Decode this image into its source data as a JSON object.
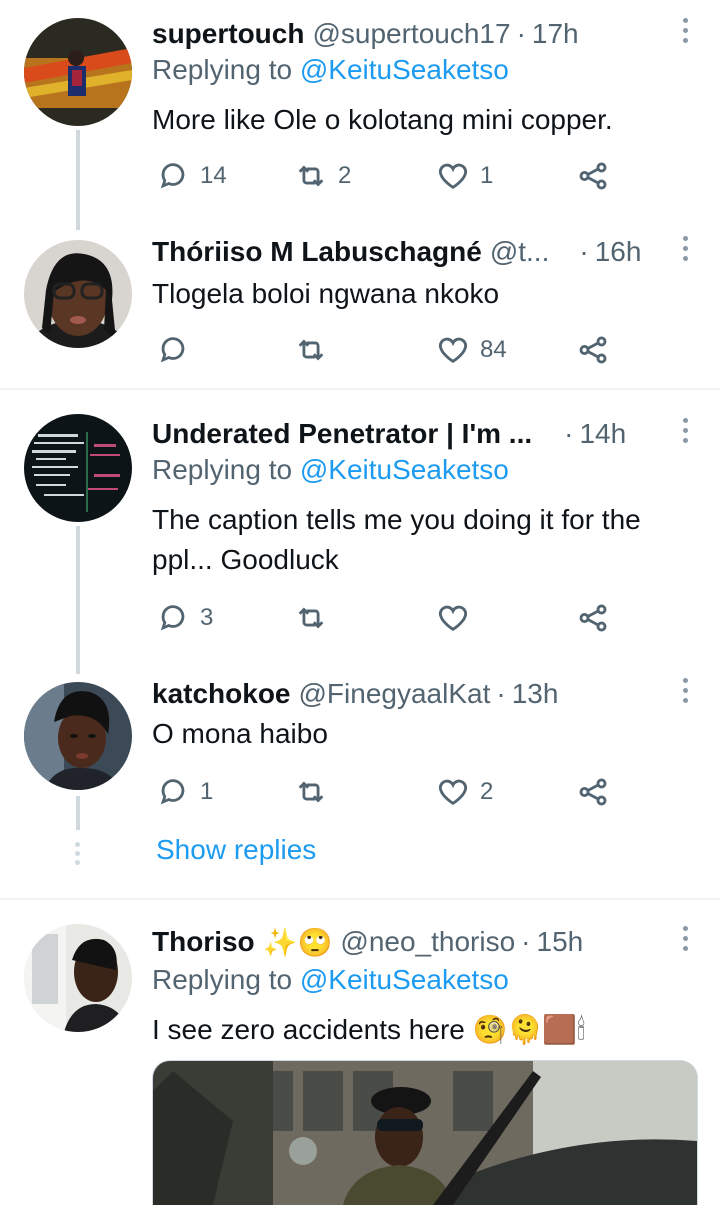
{
  "tweets": [
    {
      "name": "supertouch",
      "handle": "@supertouch17",
      "time": "17h",
      "replying_label": "Replying to",
      "replying_to": "@KeituSeaketso",
      "text": "More like Ole o kolotang mini copper.",
      "replies": "14",
      "retweets": "2",
      "likes": "1"
    },
    {
      "name": "Thóriiso M Labuschagné",
      "handle": "@t...",
      "time": "16h",
      "text": "Tlogela boloi ngwana nkoko",
      "replies": "",
      "retweets": "",
      "likes": "84"
    },
    {
      "name": "Underated Penetrator | I'm ...",
      "handle": "",
      "time": "14h",
      "replying_label": "Replying to",
      "replying_to": "@KeituSeaketso",
      "text": "The caption tells me you doing it for the ppl... Goodluck",
      "replies": "3",
      "retweets": "",
      "likes": ""
    },
    {
      "name": "katchokoe",
      "handle": "@FinegyaalKat",
      "time": "13h",
      "text": "O mona haibo",
      "replies": "1",
      "retweets": "",
      "likes": "2"
    },
    {
      "name": "Thoriso",
      "name_emoji": "✨🙄",
      "handle": "@neo_thoriso",
      "time": "15h",
      "replying_label": "Replying to",
      "replying_to": "@KeituSeaketso",
      "text": "I see zero accidents here 🧐🫠🟫🕯"
    }
  ],
  "show_replies": "Show replies",
  "colors": {
    "link": "#1d9bf0",
    "secondary": "#536471",
    "text": "#0f1419",
    "thread_line": "#cfd9de",
    "separator": "#eff3f4"
  },
  "icons": {
    "reply": "reply-icon",
    "retweet": "retweet-icon",
    "like": "heart-icon",
    "share": "share-icon",
    "more": "more-icon"
  }
}
